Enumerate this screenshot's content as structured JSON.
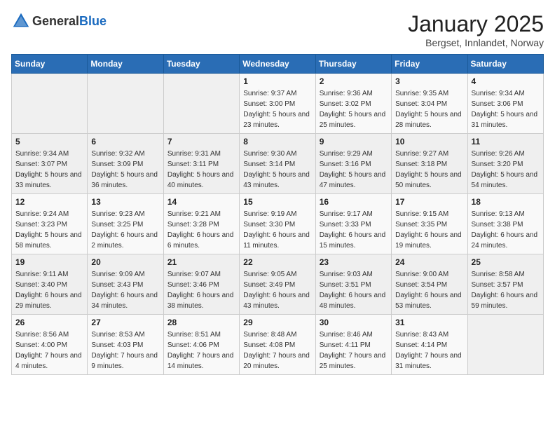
{
  "header": {
    "logo_general": "General",
    "logo_blue": "Blue",
    "month": "January 2025",
    "location": "Bergset, Innlandet, Norway"
  },
  "weekdays": [
    "Sunday",
    "Monday",
    "Tuesday",
    "Wednesday",
    "Thursday",
    "Friday",
    "Saturday"
  ],
  "weeks": [
    [
      {
        "day": "",
        "info": ""
      },
      {
        "day": "",
        "info": ""
      },
      {
        "day": "",
        "info": ""
      },
      {
        "day": "1",
        "info": "Sunrise: 9:37 AM\nSunset: 3:00 PM\nDaylight: 5 hours and 23 minutes."
      },
      {
        "day": "2",
        "info": "Sunrise: 9:36 AM\nSunset: 3:02 PM\nDaylight: 5 hours and 25 minutes."
      },
      {
        "day": "3",
        "info": "Sunrise: 9:35 AM\nSunset: 3:04 PM\nDaylight: 5 hours and 28 minutes."
      },
      {
        "day": "4",
        "info": "Sunrise: 9:34 AM\nSunset: 3:06 PM\nDaylight: 5 hours and 31 minutes."
      }
    ],
    [
      {
        "day": "5",
        "info": "Sunrise: 9:34 AM\nSunset: 3:07 PM\nDaylight: 5 hours and 33 minutes."
      },
      {
        "day": "6",
        "info": "Sunrise: 9:32 AM\nSunset: 3:09 PM\nDaylight: 5 hours and 36 minutes."
      },
      {
        "day": "7",
        "info": "Sunrise: 9:31 AM\nSunset: 3:11 PM\nDaylight: 5 hours and 40 minutes."
      },
      {
        "day": "8",
        "info": "Sunrise: 9:30 AM\nSunset: 3:14 PM\nDaylight: 5 hours and 43 minutes."
      },
      {
        "day": "9",
        "info": "Sunrise: 9:29 AM\nSunset: 3:16 PM\nDaylight: 5 hours and 47 minutes."
      },
      {
        "day": "10",
        "info": "Sunrise: 9:27 AM\nSunset: 3:18 PM\nDaylight: 5 hours and 50 minutes."
      },
      {
        "day": "11",
        "info": "Sunrise: 9:26 AM\nSunset: 3:20 PM\nDaylight: 5 hours and 54 minutes."
      }
    ],
    [
      {
        "day": "12",
        "info": "Sunrise: 9:24 AM\nSunset: 3:23 PM\nDaylight: 5 hours and 58 minutes."
      },
      {
        "day": "13",
        "info": "Sunrise: 9:23 AM\nSunset: 3:25 PM\nDaylight: 6 hours and 2 minutes."
      },
      {
        "day": "14",
        "info": "Sunrise: 9:21 AM\nSunset: 3:28 PM\nDaylight: 6 hours and 6 minutes."
      },
      {
        "day": "15",
        "info": "Sunrise: 9:19 AM\nSunset: 3:30 PM\nDaylight: 6 hours and 11 minutes."
      },
      {
        "day": "16",
        "info": "Sunrise: 9:17 AM\nSunset: 3:33 PM\nDaylight: 6 hours and 15 minutes."
      },
      {
        "day": "17",
        "info": "Sunrise: 9:15 AM\nSunset: 3:35 PM\nDaylight: 6 hours and 19 minutes."
      },
      {
        "day": "18",
        "info": "Sunrise: 9:13 AM\nSunset: 3:38 PM\nDaylight: 6 hours and 24 minutes."
      }
    ],
    [
      {
        "day": "19",
        "info": "Sunrise: 9:11 AM\nSunset: 3:40 PM\nDaylight: 6 hours and 29 minutes."
      },
      {
        "day": "20",
        "info": "Sunrise: 9:09 AM\nSunset: 3:43 PM\nDaylight: 6 hours and 34 minutes."
      },
      {
        "day": "21",
        "info": "Sunrise: 9:07 AM\nSunset: 3:46 PM\nDaylight: 6 hours and 38 minutes."
      },
      {
        "day": "22",
        "info": "Sunrise: 9:05 AM\nSunset: 3:49 PM\nDaylight: 6 hours and 43 minutes."
      },
      {
        "day": "23",
        "info": "Sunrise: 9:03 AM\nSunset: 3:51 PM\nDaylight: 6 hours and 48 minutes."
      },
      {
        "day": "24",
        "info": "Sunrise: 9:00 AM\nSunset: 3:54 PM\nDaylight: 6 hours and 53 minutes."
      },
      {
        "day": "25",
        "info": "Sunrise: 8:58 AM\nSunset: 3:57 PM\nDaylight: 6 hours and 59 minutes."
      }
    ],
    [
      {
        "day": "26",
        "info": "Sunrise: 8:56 AM\nSunset: 4:00 PM\nDaylight: 7 hours and 4 minutes."
      },
      {
        "day": "27",
        "info": "Sunrise: 8:53 AM\nSunset: 4:03 PM\nDaylight: 7 hours and 9 minutes."
      },
      {
        "day": "28",
        "info": "Sunrise: 8:51 AM\nSunset: 4:06 PM\nDaylight: 7 hours and 14 minutes."
      },
      {
        "day": "29",
        "info": "Sunrise: 8:48 AM\nSunset: 4:08 PM\nDaylight: 7 hours and 20 minutes."
      },
      {
        "day": "30",
        "info": "Sunrise: 8:46 AM\nSunset: 4:11 PM\nDaylight: 7 hours and 25 minutes."
      },
      {
        "day": "31",
        "info": "Sunrise: 8:43 AM\nSunset: 4:14 PM\nDaylight: 7 hours and 31 minutes."
      },
      {
        "day": "",
        "info": ""
      }
    ]
  ]
}
